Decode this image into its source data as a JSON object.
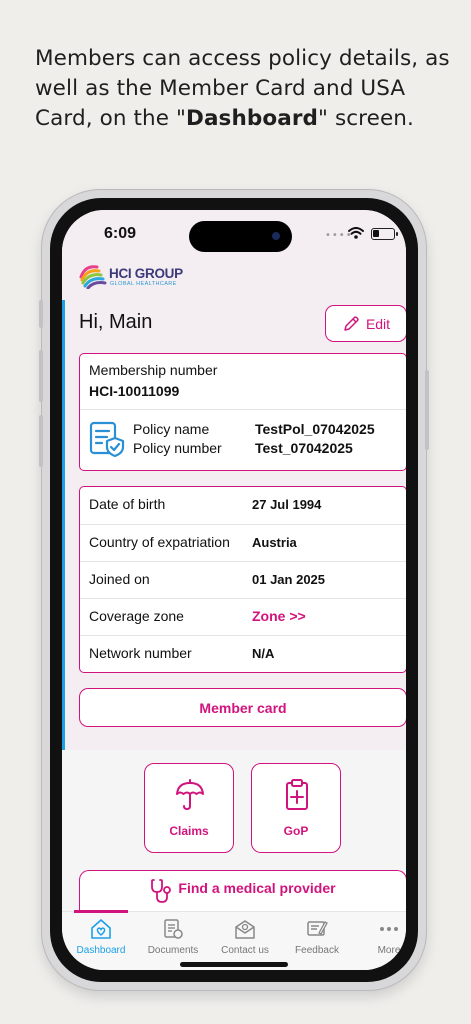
{
  "caption": {
    "pre": "Members can access policy details, as well as the Member Card and USA Card, on the \"",
    "bold": "Dashboard",
    "post": "\" screen."
  },
  "status_bar": {
    "time": "6:09",
    "signal": "••••"
  },
  "logo": {
    "name": "HCI GROUP",
    "tagline": "GLOBAL HEALTHCARE"
  },
  "header": {
    "greeting": "Hi, Main",
    "edit_label": "Edit"
  },
  "membership": {
    "label": "Membership number",
    "value": "HCI-10011099",
    "policy_name_label": "Policy name",
    "policy_name_value": "TestPol_07042025",
    "policy_number_label": "Policy number",
    "policy_number_value": "Test_07042025"
  },
  "details": [
    {
      "label": "Date of birth",
      "value": "27 Jul 1994"
    },
    {
      "label": "Country of expatriation",
      "value": "Austria"
    },
    {
      "label": "Joined on",
      "value": "01 Jan 2025"
    },
    {
      "label": "Coverage zone",
      "value": "Zone >>"
    },
    {
      "label": "Network number",
      "value": "N/A"
    }
  ],
  "member_card_label": "Member card",
  "tiles": {
    "claims": "Claims",
    "gop": "GoP"
  },
  "find_provider_label": "Find a medical provider",
  "tabs": [
    {
      "label": "Dashboard",
      "icon": "home-icon"
    },
    {
      "label": "Documents",
      "icon": "documents-icon"
    },
    {
      "label": "Contact us",
      "icon": "mail-icon"
    },
    {
      "label": "Feedback",
      "icon": "feedback-icon"
    },
    {
      "label": "More",
      "icon": "more-icon"
    }
  ],
  "colors": {
    "accent": "#d1147d",
    "active_tab": "#1ba0e8",
    "header_bg": "#f4edf2"
  }
}
